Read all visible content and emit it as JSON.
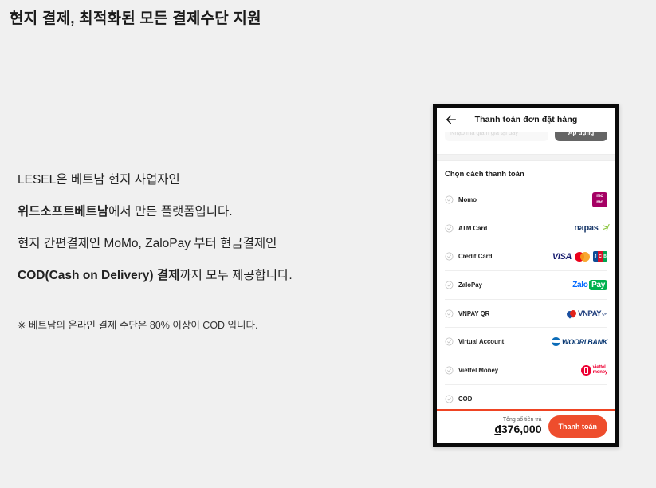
{
  "page": {
    "title": "현지 결제,  최적화된 모든 결제수단 지원",
    "background_color": "#f0f0f0",
    "copy_lines": [
      {
        "plain_before": "LESEL은 베트남 현지 사업자인",
        "bold": "",
        "plain_after": ""
      },
      {
        "plain_before": "",
        "bold": "위드소프트베트남",
        "plain_after": "에서 만든 플랫폼입니다."
      },
      {
        "plain_before": "현지 간편결제인 MoMo, ZaloPay 부터 현금결제인",
        "bold": "",
        "plain_after": ""
      },
      {
        "plain_before": "",
        "bold": "COD(Cash on Delivery) 결제",
        "plain_after": "까지 모두 제공합니다."
      }
    ],
    "footnote": "※ 베트남의 온라인 결제 수단은 80% 이상이 COD 입니다."
  },
  "phone": {
    "header": {
      "back_icon": "arrow-left-icon",
      "title": "Thanh toán đơn đặt hàng"
    },
    "coupon": {
      "placeholder": "Nhập mã giảm giá tại đây",
      "value": "",
      "apply_label": "Áp dụng"
    },
    "payment_section": {
      "title": "Chọn cách thanh toán",
      "methods": [
        {
          "label": "Momo",
          "logo": "momo-logo",
          "selected": false
        },
        {
          "label": "ATM Card",
          "logo": "napas-logo",
          "selected": false
        },
        {
          "label": "Credit Card",
          "logo": "visa-mastercard-jcb-logos",
          "selected": false
        },
        {
          "label": "ZaloPay",
          "logo": "zalopay-logo",
          "selected": false
        },
        {
          "label": "VNPAY QR",
          "logo": "vnpay-logo",
          "selected": false
        },
        {
          "label": "Virtual Account",
          "logo": "woori-bank-logo",
          "selected": false
        },
        {
          "label": "Viettel Money",
          "logo": "viettel-money-logo",
          "selected": false
        },
        {
          "label": "COD",
          "logo": "",
          "selected": false
        }
      ]
    },
    "bottom_bar": {
      "total_label": "Tổng số tiền trả",
      "currency_symbol": "đ",
      "total_amount": "376,000",
      "pay_button_label": "Thanh toán",
      "accent_color": "#ee4d2d"
    },
    "logo_text": {
      "momo_top": "mo",
      "momo_bottom": "mo",
      "napas": "napas",
      "napas_mark": "≯",
      "visa": "VISA",
      "jcb_j": "J",
      "jcb_c": "C",
      "jcb_b": "B",
      "zalo": "Zalo",
      "zalo_pay": "Pay",
      "vnpay": "VNPAY",
      "vnpay_sup": "QR",
      "woori": "WOORI BANK",
      "viettel_top": "viettel",
      "viettel_bottom": "money"
    }
  }
}
